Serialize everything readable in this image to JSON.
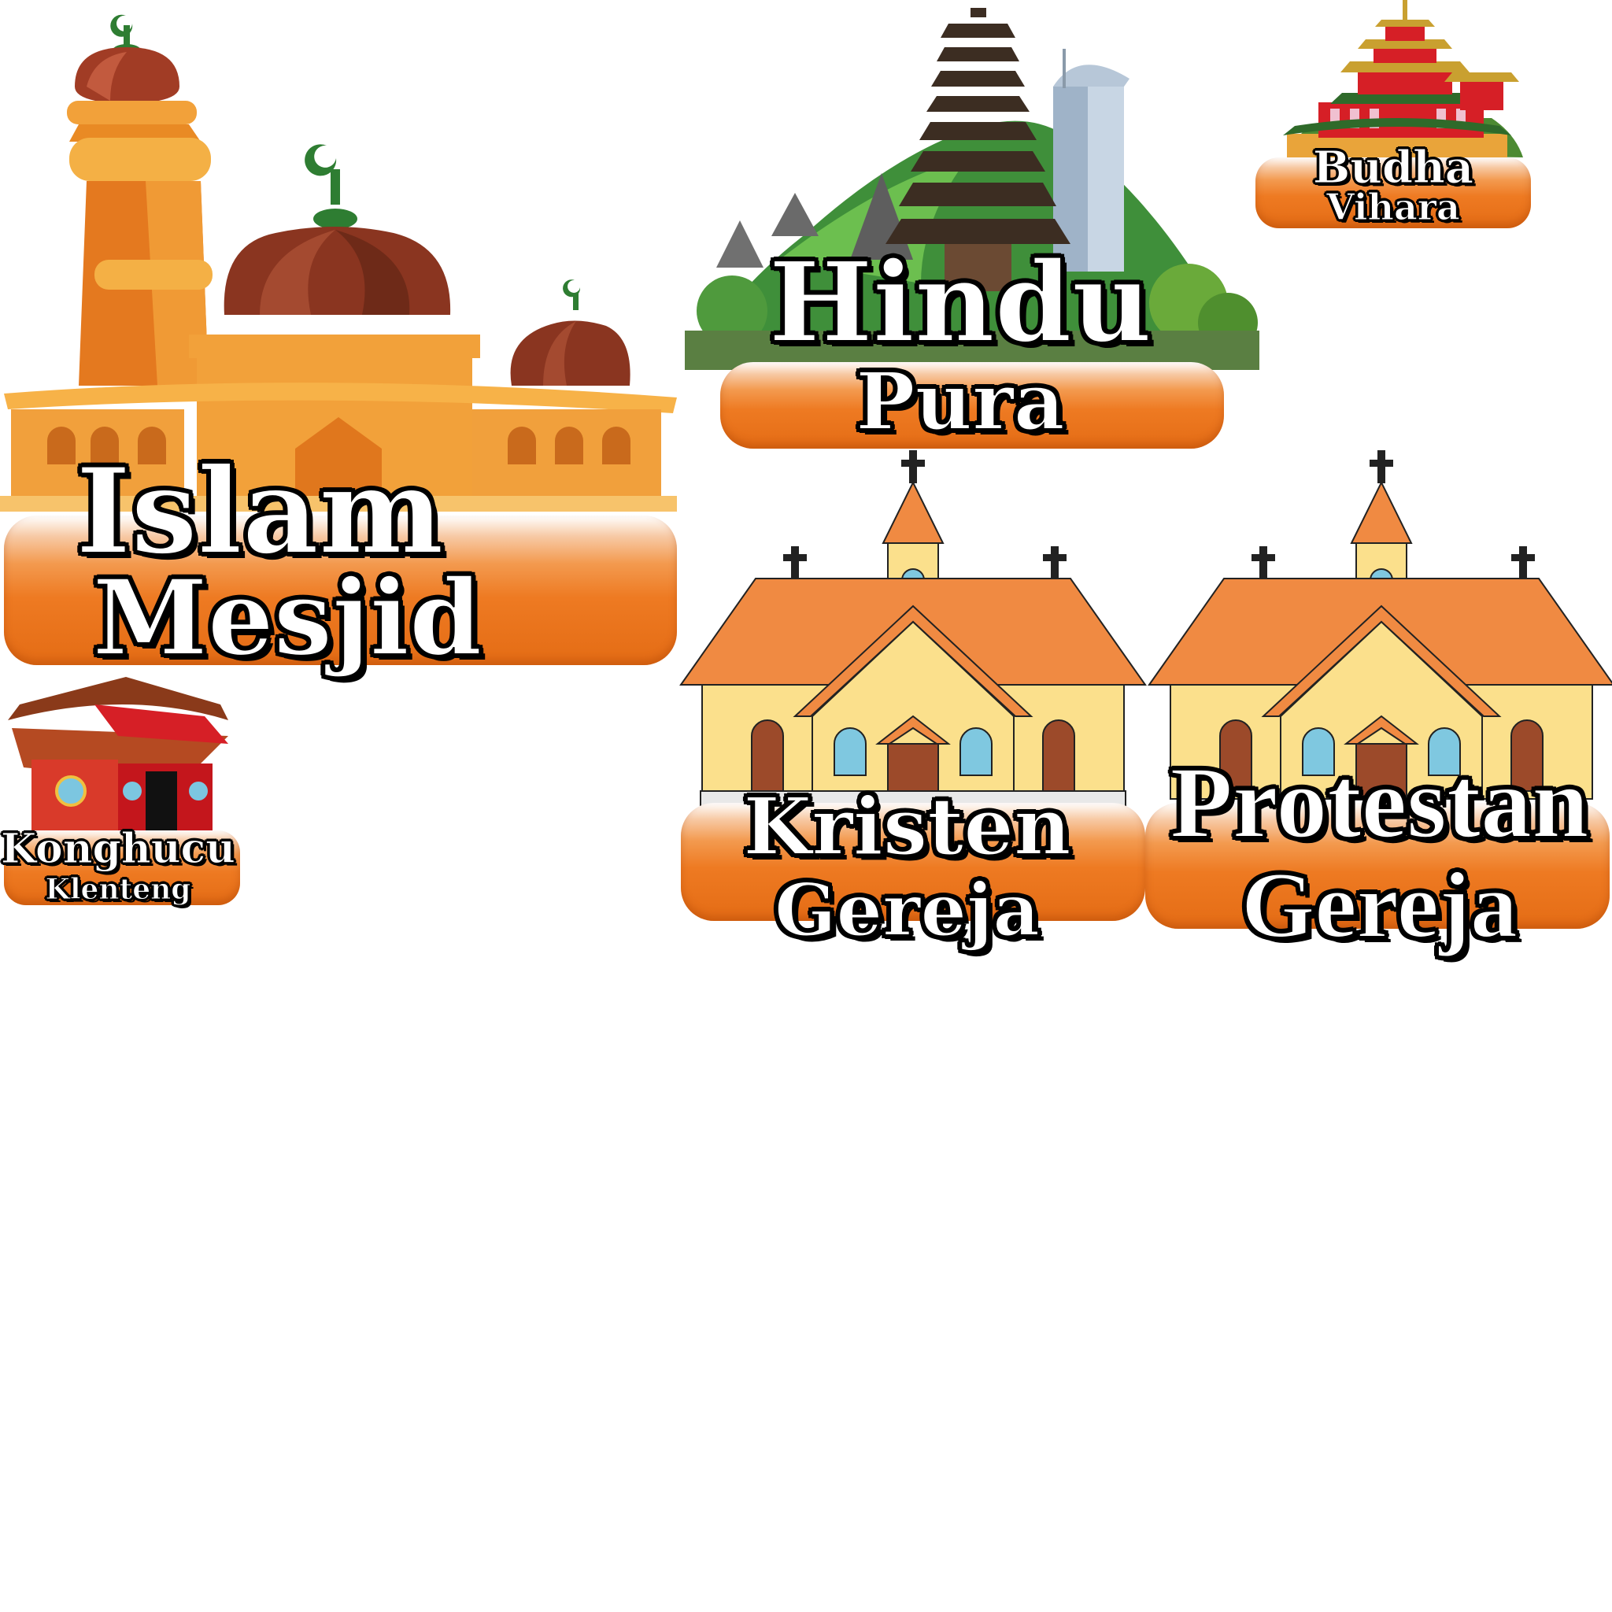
{
  "colors": {
    "plate_orange": "#ee7a22",
    "mosque_orange": "#f0922e",
    "dome_red": "#8a3520",
    "crescent_green": "#2e7d32",
    "church_roof": "#f08a42",
    "church_wall": "#fbe08c",
    "temple_red": "#d61f26",
    "label_text": "#ffffff",
    "label_outline": "#000000"
  },
  "cards": [
    {
      "id": "islam",
      "religion": "Islam",
      "place": "Mesjid",
      "icon": "mosque-icon"
    },
    {
      "id": "hindu",
      "religion": "Hindu",
      "place": "Pura",
      "icon": "balinese-pura-icon"
    },
    {
      "id": "budha",
      "religion": "Budha",
      "place": "Vihara",
      "icon": "pagoda-icon"
    },
    {
      "id": "konghucu",
      "religion": "Konghucu",
      "place": "Klenteng",
      "icon": "klenteng-icon"
    },
    {
      "id": "kristen",
      "religion": "Kristen",
      "place": "Gereja",
      "icon": "church-icon"
    },
    {
      "id": "protestan",
      "religion": "Protestan",
      "place": "Gereja",
      "icon": "church-icon"
    }
  ]
}
